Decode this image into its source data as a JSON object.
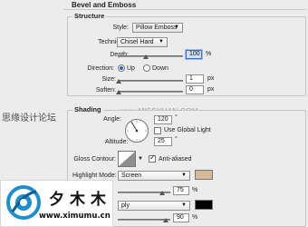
{
  "window": {
    "section_title": "Bevel and Emboss"
  },
  "structure": {
    "title": "Structure",
    "style_label": "Style:",
    "style_value": "Pillow Emboss",
    "technique_label": "Technique:",
    "technique_value": "Chisel Hard",
    "depth_label": "Depth:",
    "depth_value": "100",
    "depth_unit": "%",
    "depth_level_percent": 100,
    "direction_label": "Direction:",
    "direction_up": "Up",
    "direction_down": "Down",
    "direction_selected": "Up",
    "size_label": "Size:",
    "size_value": "1",
    "size_unit": "px",
    "soften_label": "Soften:",
    "soften_value": "0",
    "soften_unit": "px"
  },
  "shading": {
    "title": "Shading",
    "angle_label": "Angle:",
    "angle_value": "120",
    "angle_unit": "°",
    "global_light_label": "Use Global Light",
    "global_light_checked": false,
    "altitude_label": "Altitude:",
    "altitude_value": "25",
    "altitude_unit": "°",
    "gloss_contour_label": "Gloss Contour:",
    "anti_aliased_label": "Anti-aliased",
    "anti_aliased_checked": true,
    "highlight_mode_label": "Highlight Mode:",
    "highlight_mode_value": "Screen",
    "highlight_color": "#d7b896",
    "highlight_opacity_value": "75",
    "highlight_opacity_unit": "%",
    "shadow_mode_value": "ply",
    "shadow_color": "#000000",
    "shadow_opacity_value": "90",
    "shadow_opacity_unit": "%"
  },
  "overlay": {
    "side_text": "思缘设计论坛",
    "watermark_url": "www.MISSYUAN.COM"
  },
  "logo": {
    "chars": "夕木木",
    "url": "www.ximumu.cn",
    "accent_color": "#1a8fd1"
  }
}
